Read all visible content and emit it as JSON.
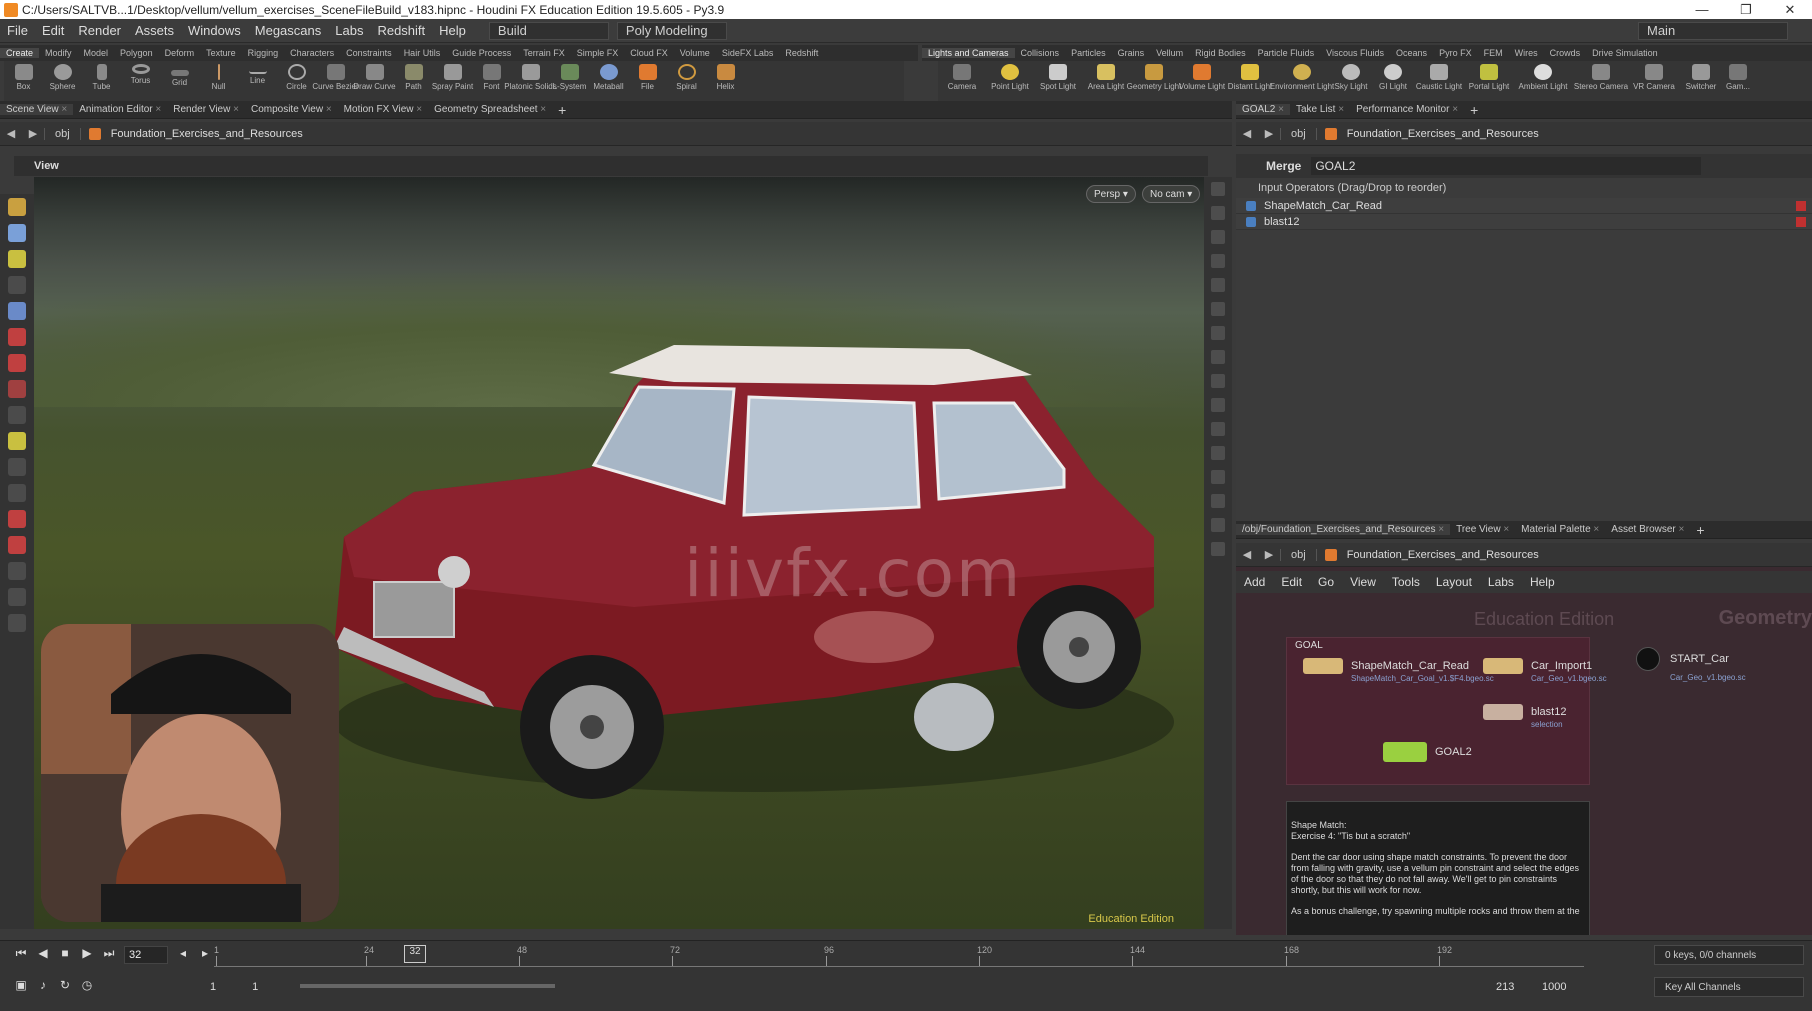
{
  "window": {
    "title": "C:/Users/SALTVB...1/Desktop/vellum/vellum_exercises_SceneFileBuild_v183.hipnc - Houdini FX Education Edition 19.5.605 - Py3.9",
    "minimize": "—",
    "maximize": "❐",
    "close": "✕"
  },
  "menu": {
    "items": [
      "File",
      "Edit",
      "Render",
      "Assets",
      "Windows",
      "Megascans",
      "Labs",
      "Redshift",
      "Help"
    ],
    "desktop_build": "Build",
    "desktop_poly": "Poly Modeling",
    "desktop_main": "Main"
  },
  "shelf_left": {
    "tabs": [
      "Create",
      "Modify",
      "Model",
      "Polygon",
      "Deform",
      "Texture",
      "Rigging",
      "Characters",
      "Constraints",
      "Hair Utils",
      "Guide Process",
      "Terrain FX",
      "Simple FX",
      "Cloud FX",
      "Volume",
      "SideFX Labs",
      "Redshift"
    ],
    "tools": [
      "Box",
      "Sphere",
      "Tube",
      "Torus",
      "Grid",
      "Null",
      "Line",
      "Circle",
      "Curve Bezier",
      "Draw Curve",
      "Path",
      "Spray Paint",
      "Font",
      "Platonic Solids",
      "L-System",
      "Metaball",
      "File",
      "Spiral",
      "Helix"
    ]
  },
  "shelf_right": {
    "tabs": [
      "Lights and Cameras",
      "Collisions",
      "Particles",
      "Grains",
      "Vellum",
      "Rigid Bodies",
      "Particle Fluids",
      "Viscous Fluids",
      "Oceans",
      "Pyro FX",
      "FEM",
      "Wires",
      "Crowds",
      "Drive Simulation"
    ],
    "tools": [
      "Camera",
      "Point Light",
      "Spot Light",
      "Area Light",
      "Geometry Light",
      "Volume Light",
      "Distant Light",
      "Environment Light",
      "Sky Light",
      "GI Light",
      "Caustic Light",
      "Portal Light",
      "Ambient Light",
      "Stereo Camera",
      "VR Camera",
      "Switcher",
      "Gam..."
    ]
  },
  "viewer_tabs": [
    "Scene View",
    "Animation Editor",
    "Render View",
    "Composite View",
    "Motion FX View",
    "Geometry Spreadsheet"
  ],
  "viewer_path": {
    "context": "obj",
    "network": "Foundation_Exercises_and_Resources"
  },
  "viewer": {
    "label": "View",
    "persp": "Persp ▾",
    "cam": "No cam ▾",
    "watermark": "iiivfx.com",
    "edition_label": "Education Edition"
  },
  "param_tabs": [
    "GOAL2",
    "Take List",
    "Performance Monitor"
  ],
  "param_path": {
    "context": "obj",
    "network": "Foundation_Exercises_and_Resources"
  },
  "params": {
    "node_type": "Merge",
    "node_name": "GOAL2",
    "inputs_label": "Input Operators (Drag/Drop to reorder)",
    "inputs": [
      "ShapeMatch_Car_Read",
      "blast12"
    ]
  },
  "net_tabs": [
    "/obj/Foundation_Exercises_and_Resources",
    "Tree View",
    "Material Palette",
    "Asset Browser"
  ],
  "net_path": {
    "context": "obj",
    "network": "Foundation_Exercises_and_Resources"
  },
  "net_menu": [
    "Add",
    "Edit",
    "Go",
    "View",
    "Tools",
    "Layout",
    "Labs",
    "Help"
  ],
  "network": {
    "bg_title": "Education Edition",
    "bg_context": "Geometry",
    "box_title": "GOAL",
    "nodes": [
      {
        "name": "ShapeMatch_Car_Read",
        "sub": "ShapeMatch_Car_Goal_v1.$F4.bgeo.sc"
      },
      {
        "name": "Car_Import1",
        "sub": "Car_Geo_v1.bgeo.sc"
      },
      {
        "name": "blast12",
        "sub": "selection"
      },
      {
        "name": "GOAL2",
        "sub": ""
      }
    ],
    "start_node": {
      "name": "START_Car",
      "sub": "Car_Geo_v1.bgeo.sc"
    },
    "note_title": "Shape Match:",
    "note_subtitle": "Exercise 4: \"Tis but a scratch\"",
    "note_body": "Dent the car door using shape match constraints. To prevent the door from falling with gravity, use a vellum pin constraint and select the edges of the door so that they do not fall away. We'll get to pin constraints shortly, but this will work for now.",
    "note_bonus": "As a bonus challenge, try spawning multiple rocks and throw them at the"
  },
  "timeline": {
    "current_frame": "32",
    "playhead_label": "32",
    "ticks": [
      "1",
      "24",
      "48",
      "72",
      "96",
      "120",
      "144",
      "168",
      "192"
    ],
    "range_start": "1",
    "range_start2": "1",
    "range_end": "213",
    "range_end2": "1000",
    "keys_channels": "0 keys, 0/0 channels",
    "key_all": "Key All Channels"
  }
}
